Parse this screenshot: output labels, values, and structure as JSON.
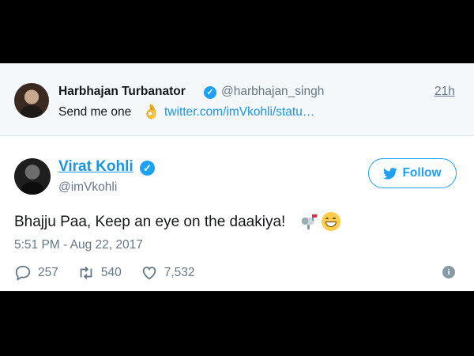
{
  "parent_tweet": {
    "name": "Harbhajan Turbanator",
    "handle": "@harbhajan_singh",
    "time": "21h",
    "text": "Send me one",
    "emoji_icon": "ok-hand-icon",
    "link": "twitter.com/imVkohli/statu…"
  },
  "tweet": {
    "name": "Virat Kohli",
    "handle": "@imVkohli",
    "text": "Bhajju Paa, Keep an eye on the daakiya!",
    "emojis": [
      "mailbox-icon",
      "grinning-face-icon"
    ],
    "timestamp": "5:51 PM - Aug 22, 2017",
    "follow_label": "Follow",
    "replies": "257",
    "retweets": "540",
    "likes": "7,532"
  },
  "colors": {
    "accent": "#1da1f2",
    "link": "#1b95e0",
    "muted": "#657786",
    "parent_bg": "#f5f8fa"
  }
}
